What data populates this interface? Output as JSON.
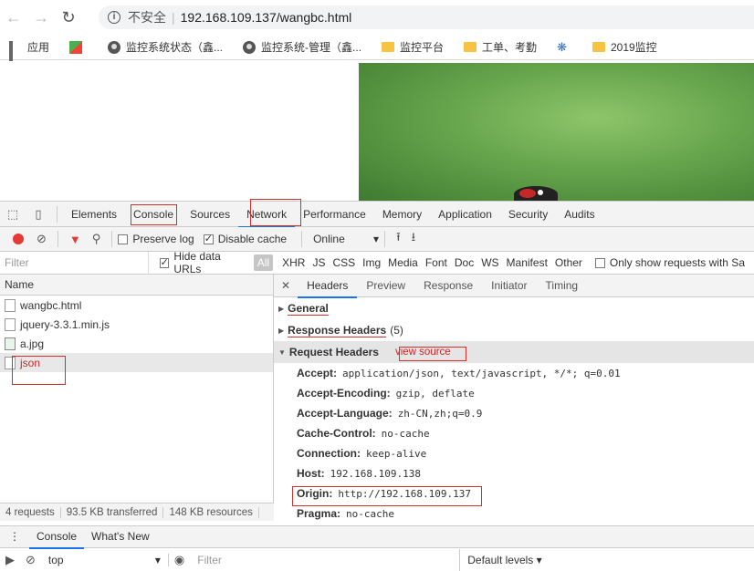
{
  "browser": {
    "not_secure": "不安全",
    "url": "192.168.109.137/wangbc.html"
  },
  "bookmarks": [
    {
      "label": "应用",
      "icon": "apps-icon"
    },
    {
      "label": "",
      "icon": "puzzle-icon"
    },
    {
      "label": "监控系统状态（鑫...",
      "icon": "globe-icon"
    },
    {
      "label": "监控系统-管理（鑫...",
      "icon": "globe-icon"
    },
    {
      "label": "监控平台",
      "icon": "folder-icon"
    },
    {
      "label": "工单、考勤",
      "icon": "folder-icon"
    },
    {
      "label": "",
      "icon": "paw-icon"
    },
    {
      "label": "2019监控",
      "icon": "folder-icon"
    }
  ],
  "devtools": {
    "tabs": [
      "Elements",
      "Console",
      "Sources",
      "Network",
      "Performance",
      "Memory",
      "Application",
      "Security",
      "Audits"
    ],
    "active_tab": "Network",
    "toolbar": {
      "preserve_log": "Preserve log",
      "disable_cache": "Disable cache",
      "throttle": "Online"
    },
    "filter_placeholder": "Filter",
    "hide_data_urls": "Hide data URLs",
    "types": [
      "All",
      "XHR",
      "JS",
      "CSS",
      "Img",
      "Media",
      "Font",
      "Doc",
      "WS",
      "Manifest",
      "Other"
    ],
    "only_show": "Only show requests with Sa",
    "name_header": "Name",
    "requests": [
      {
        "name": "wangbc.html",
        "icon": "document-icon"
      },
      {
        "name": "jquery-3.3.1.min.js",
        "icon": "document-icon"
      },
      {
        "name": "a.jpg",
        "icon": "image-icon"
      },
      {
        "name": "json",
        "icon": "document-icon"
      }
    ],
    "summary": {
      "requests": "4 requests",
      "transferred": "93.5 KB transferred",
      "resources": "148 KB resources"
    },
    "detail_tabs": [
      "Headers",
      "Preview",
      "Response",
      "Initiator",
      "Timing"
    ],
    "sections": {
      "general": "General",
      "response_headers": "Response Headers",
      "response_count": "(5)",
      "request_headers": "Request Headers",
      "view_source": "view source"
    },
    "request_headers": [
      {
        "key": "Accept:",
        "value": "application/json, text/javascript, */*; q=0.01"
      },
      {
        "key": "Accept-Encoding:",
        "value": "gzip, deflate"
      },
      {
        "key": "Accept-Language:",
        "value": "zh-CN,zh;q=0.9"
      },
      {
        "key": "Cache-Control:",
        "value": "no-cache"
      },
      {
        "key": "Connection:",
        "value": "keep-alive"
      },
      {
        "key": "Host:",
        "value": "192.168.109.138"
      },
      {
        "key": "Origin:",
        "value": "http://192.168.109.137"
      },
      {
        "key": "Pragma:",
        "value": "no-cache"
      }
    ],
    "drawer_tabs": [
      "Console",
      "What's New"
    ],
    "console_context": "top",
    "console_filter": "Filter",
    "console_levels": "Default levels ▾"
  }
}
